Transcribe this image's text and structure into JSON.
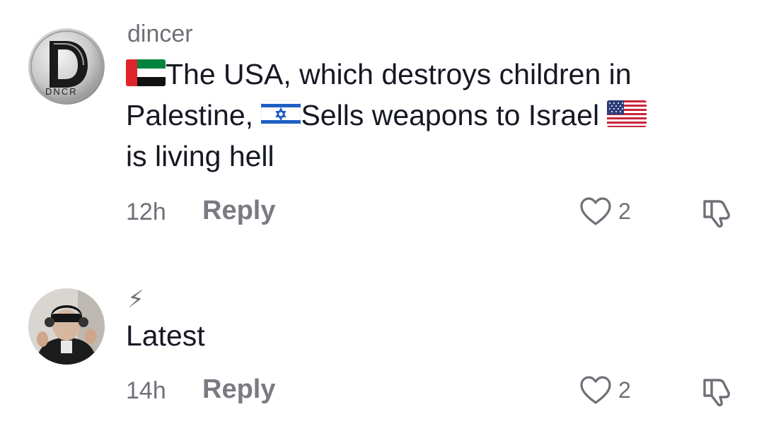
{
  "comments": [
    {
      "username": "dincer",
      "avatar_text": "DNCR",
      "avatar_initial": "D",
      "text_segments": [
        {
          "type": "flag",
          "icon": "uae-flag-icon"
        },
        {
          "type": "text",
          "value": "The USA, which destroys children in Palestine, "
        },
        {
          "type": "flag",
          "icon": "israel-flag-icon"
        },
        {
          "type": "text",
          "value": "Sells weapons to Israel "
        },
        {
          "type": "flag",
          "icon": "usa-flag-icon"
        },
        {
          "type": "text",
          "value": " is living hell"
        }
      ],
      "text_part_1": "The USA, which destroys children in Palestine, ",
      "text_part_2": "Sells weapons to Israel ",
      "text_part_3": "is living hell",
      "time": "12h",
      "reply_label": "Reply",
      "like_count": "2"
    },
    {
      "username": "⚡",
      "text": "Latest",
      "time": "14h",
      "reply_label": "Reply",
      "like_count": "2"
    }
  ],
  "colors": {
    "primary_text": "#161823",
    "secondary_text": "#6f7077",
    "background": "#ffffff"
  }
}
